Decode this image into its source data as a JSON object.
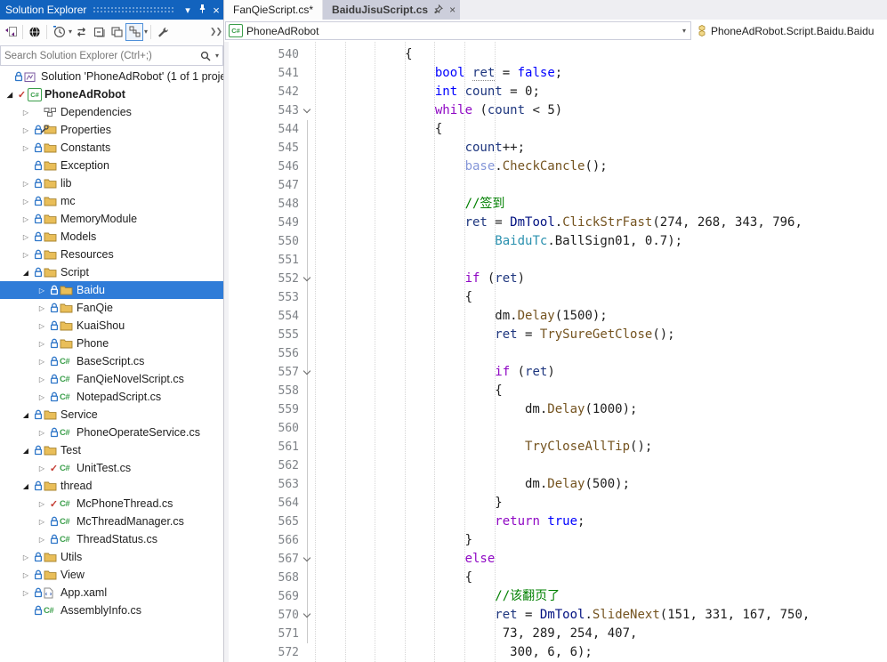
{
  "solution_explorer": {
    "title": "Solution Explorer",
    "titlebar_icons": [
      "window-position-icon",
      "pin-icon",
      "close-icon"
    ],
    "toolbar_icons": [
      "switch-views-icon",
      "pending-changes-filter-icon",
      "open-files-filter-icon",
      "sync-icon",
      "collapse-all-icon",
      "properties-icon",
      "sync-with-active-document-icon",
      "settings-wrench-icon",
      "overflow-icon"
    ],
    "search_placeholder": "Search Solution Explorer (Ctrl+;)",
    "search_icons": [
      "search-icon",
      "search-options-icon"
    ],
    "tree": [
      {
        "label": "Solution 'PhoneAdRobot' (1 of 1 proje",
        "indent": 0,
        "expander": "none",
        "badge": "lock",
        "icon": "solution",
        "selected": false
      },
      {
        "label": "PhoneAdRobot",
        "indent": 1,
        "expander": "open",
        "badge": "check",
        "icon": "project",
        "selected": false,
        "bold": true
      },
      {
        "label": "Dependencies",
        "indent": 2,
        "expander": "closed",
        "badge": "none",
        "icon": "deps",
        "selected": false
      },
      {
        "label": "Properties",
        "indent": 2,
        "expander": "closed",
        "badge": "lock",
        "icon": "folder-props",
        "selected": false
      },
      {
        "label": "Constants",
        "indent": 2,
        "expander": "closed",
        "badge": "lock",
        "icon": "folder",
        "selected": false
      },
      {
        "label": "Exception",
        "indent": 2,
        "expander": "none",
        "badge": "lock",
        "icon": "folder",
        "selected": false
      },
      {
        "label": "lib",
        "indent": 2,
        "expander": "closed",
        "badge": "lock",
        "icon": "folder",
        "selected": false
      },
      {
        "label": "mc",
        "indent": 2,
        "expander": "closed",
        "badge": "lock",
        "icon": "folder",
        "selected": false
      },
      {
        "label": "MemoryModule",
        "indent": 2,
        "expander": "closed",
        "badge": "lock",
        "icon": "folder",
        "selected": false
      },
      {
        "label": "Models",
        "indent": 2,
        "expander": "closed",
        "badge": "lock",
        "icon": "folder",
        "selected": false
      },
      {
        "label": "Resources",
        "indent": 2,
        "expander": "closed",
        "badge": "lock",
        "icon": "folder",
        "selected": false
      },
      {
        "label": "Script",
        "indent": 2,
        "expander": "open",
        "badge": "lock",
        "icon": "folder",
        "selected": false
      },
      {
        "label": "Baidu",
        "indent": 3,
        "expander": "closed",
        "badge": "lock",
        "icon": "folder",
        "selected": true
      },
      {
        "label": "FanQie",
        "indent": 3,
        "expander": "closed",
        "badge": "lock",
        "icon": "folder",
        "selected": false
      },
      {
        "label": "KuaiShou",
        "indent": 3,
        "expander": "closed",
        "badge": "lock",
        "icon": "folder",
        "selected": false
      },
      {
        "label": "Phone",
        "indent": 3,
        "expander": "closed",
        "badge": "lock",
        "icon": "folder",
        "selected": false
      },
      {
        "label": "BaseScript.cs",
        "indent": 3,
        "expander": "closed",
        "badge": "lock",
        "icon": "cs",
        "selected": false
      },
      {
        "label": "FanQieNovelScript.cs",
        "indent": 3,
        "expander": "closed",
        "badge": "lock",
        "icon": "cs",
        "selected": false
      },
      {
        "label": "NotepadScript.cs",
        "indent": 3,
        "expander": "closed",
        "badge": "lock",
        "icon": "cs",
        "selected": false
      },
      {
        "label": "Service",
        "indent": 2,
        "expander": "open",
        "badge": "lock",
        "icon": "folder",
        "selected": false
      },
      {
        "label": "PhoneOperateService.cs",
        "indent": 3,
        "expander": "closed",
        "badge": "lock",
        "icon": "cs",
        "selected": false
      },
      {
        "label": "Test",
        "indent": 2,
        "expander": "open",
        "badge": "lock",
        "icon": "folder",
        "selected": false
      },
      {
        "label": "UnitTest.cs",
        "indent": 3,
        "expander": "closed",
        "badge": "check",
        "icon": "cs",
        "selected": false
      },
      {
        "label": "thread",
        "indent": 2,
        "expander": "open",
        "badge": "lock",
        "icon": "folder",
        "selected": false
      },
      {
        "label": "McPhoneThread.cs",
        "indent": 3,
        "expander": "closed",
        "badge": "check",
        "icon": "cs",
        "selected": false
      },
      {
        "label": "McThreadManager.cs",
        "indent": 3,
        "expander": "closed",
        "badge": "lock",
        "icon": "cs",
        "selected": false
      },
      {
        "label": "ThreadStatus.cs",
        "indent": 3,
        "expander": "closed",
        "badge": "lock",
        "icon": "cs",
        "selected": false
      },
      {
        "label": "Utils",
        "indent": 2,
        "expander": "closed",
        "badge": "lock",
        "icon": "folder",
        "selected": false
      },
      {
        "label": "View",
        "indent": 2,
        "expander": "closed",
        "badge": "lock",
        "icon": "folder",
        "selected": false
      },
      {
        "label": "App.xaml",
        "indent": 2,
        "expander": "closed",
        "badge": "lock",
        "icon": "xaml",
        "selected": false
      },
      {
        "label": "AssemblyInfo.cs",
        "indent": 2,
        "expander": "none",
        "badge": "lock",
        "icon": "cs",
        "selected": false
      }
    ]
  },
  "editor": {
    "tabs": [
      {
        "label": "FanQieScript.cs*",
        "state": "inactive"
      },
      {
        "label": "BaiduJisuScript.cs",
        "state": "active-unfocused",
        "pin": true,
        "close": true
      }
    ],
    "breadcrumb": {
      "project": "PhoneAdRobot",
      "member_path": "PhoneAdRobot.Script.Baidu.Baidu"
    },
    "code": {
      "first_line_number": 540,
      "lines": [
        {
          "n": 540,
          "t": [
            [
              "pl",
              "            {"
            ]
          ]
        },
        {
          "n": 541,
          "t": [
            [
              "pl",
              "                "
            ],
            [
              "kw",
              "bool"
            ],
            [
              "pl",
              " "
            ],
            [
              "vd",
              "ret"
            ],
            [
              "pl",
              " = "
            ],
            [
              "kw",
              "false"
            ],
            [
              "pl",
              ";"
            ]
          ]
        },
        {
          "n": 542,
          "t": [
            [
              "pl",
              "                "
            ],
            [
              "kw",
              "int"
            ],
            [
              "pl",
              " "
            ],
            [
              "v",
              "count"
            ],
            [
              "pl",
              " = 0;"
            ]
          ]
        },
        {
          "n": 543,
          "f": true,
          "t": [
            [
              "pl",
              "                "
            ],
            [
              "ctrl",
              "while"
            ],
            [
              "pl",
              " ("
            ],
            [
              "v",
              "count"
            ],
            [
              "pl",
              " < 5)"
            ]
          ]
        },
        {
          "n": 544,
          "t": [
            [
              "pl",
              "                {"
            ]
          ]
        },
        {
          "n": 545,
          "t": [
            [
              "pl",
              "                    "
            ],
            [
              "v",
              "count"
            ],
            [
              "pl",
              "++;"
            ]
          ]
        },
        {
          "n": 546,
          "t": [
            [
              "pl",
              "                    "
            ],
            [
              "b",
              "base"
            ],
            [
              "pl",
              "."
            ],
            [
              "m",
              "CheckCancle"
            ],
            [
              "pl",
              "();"
            ]
          ]
        },
        {
          "n": 547,
          "t": []
        },
        {
          "n": 548,
          "t": [
            [
              "pl",
              "                    "
            ],
            [
              "c",
              "//签到"
            ]
          ]
        },
        {
          "n": 549,
          "t": [
            [
              "pl",
              "                    "
            ],
            [
              "v",
              "ret"
            ],
            [
              "pl",
              " = "
            ],
            [
              "cls",
              "DmTool"
            ],
            [
              "pl",
              "."
            ],
            [
              "m",
              "ClickStrFast"
            ],
            [
              "pl",
              "(274, 268, 343, 796,"
            ]
          ]
        },
        {
          "n": 550,
          "t": [
            [
              "pl",
              "                        "
            ],
            [
              "cls2",
              "BaiduTc"
            ],
            [
              "pl",
              "."
            ],
            [
              "pl",
              "BallSign01"
            ],
            [
              "pl",
              ", 0.7);"
            ]
          ]
        },
        {
          "n": 551,
          "t": []
        },
        {
          "n": 552,
          "f": true,
          "t": [
            [
              "pl",
              "                    "
            ],
            [
              "ctrl",
              "if"
            ],
            [
              "pl",
              " ("
            ],
            [
              "v",
              "ret"
            ],
            [
              "pl",
              ")"
            ]
          ]
        },
        {
          "n": 553,
          "t": [
            [
              "pl",
              "                    {"
            ]
          ]
        },
        {
          "n": 554,
          "t": [
            [
              "pl",
              "                        dm."
            ],
            [
              "m",
              "Delay"
            ],
            [
              "pl",
              "(1500);"
            ]
          ]
        },
        {
          "n": 555,
          "t": [
            [
              "pl",
              "                        "
            ],
            [
              "v",
              "ret"
            ],
            [
              "pl",
              " = "
            ],
            [
              "m",
              "TrySureGetClose"
            ],
            [
              "pl",
              "();"
            ]
          ]
        },
        {
          "n": 556,
          "t": []
        },
        {
          "n": 557,
          "f": true,
          "t": [
            [
              "pl",
              "                        "
            ],
            [
              "ctrl",
              "if"
            ],
            [
              "pl",
              " ("
            ],
            [
              "v",
              "ret"
            ],
            [
              "pl",
              ")"
            ]
          ]
        },
        {
          "n": 558,
          "t": [
            [
              "pl",
              "                        {"
            ]
          ]
        },
        {
          "n": 559,
          "t": [
            [
              "pl",
              "                            dm."
            ],
            [
              "m",
              "Delay"
            ],
            [
              "pl",
              "(1000);"
            ]
          ]
        },
        {
          "n": 560,
          "t": []
        },
        {
          "n": 561,
          "t": [
            [
              "pl",
              "                            "
            ],
            [
              "m",
              "TryCloseAllTip"
            ],
            [
              "pl",
              "();"
            ]
          ]
        },
        {
          "n": 562,
          "t": []
        },
        {
          "n": 563,
          "t": [
            [
              "pl",
              "                            dm."
            ],
            [
              "m",
              "Delay"
            ],
            [
              "pl",
              "(500);"
            ]
          ]
        },
        {
          "n": 564,
          "t": [
            [
              "pl",
              "                        }"
            ]
          ]
        },
        {
          "n": 565,
          "t": [
            [
              "pl",
              "                        "
            ],
            [
              "ctrl",
              "return"
            ],
            [
              "pl",
              " "
            ],
            [
              "kw",
              "true"
            ],
            [
              "pl",
              ";"
            ]
          ]
        },
        {
          "n": 566,
          "t": [
            [
              "pl",
              "                    }"
            ]
          ]
        },
        {
          "n": 567,
          "f": true,
          "t": [
            [
              "pl",
              "                    "
            ],
            [
              "ctrl",
              "else"
            ]
          ]
        },
        {
          "n": 568,
          "t": [
            [
              "pl",
              "                    {"
            ]
          ]
        },
        {
          "n": 569,
          "t": [
            [
              "pl",
              "                        "
            ],
            [
              "c",
              "//该翻页了"
            ]
          ]
        },
        {
          "n": 570,
          "f": true,
          "t": [
            [
              "pl",
              "                        "
            ],
            [
              "v",
              "ret"
            ],
            [
              "pl",
              " = "
            ],
            [
              "cls",
              "DmTool"
            ],
            [
              "pl",
              "."
            ],
            [
              "m",
              "SlideNext"
            ],
            [
              "pl",
              "(151, 331, 167, 750,"
            ]
          ]
        },
        {
          "n": 571,
          "t": [
            [
              "pl",
              "                         73, 289, 254, 407,"
            ]
          ]
        },
        {
          "n": 572,
          "t": [
            [
              "pl",
              "                          300, 6, 6);"
            ]
          ]
        }
      ]
    }
  },
  "colors": {
    "titlebar": "#1263BE",
    "tree_selection": "#2F7CD8",
    "tab_active_bg": "#CCCEDB",
    "tabstrip_bg": "#EEEEF2",
    "keyword": "#0000FF",
    "control_keyword": "#8F08C4",
    "method": "#74531F",
    "local_variable": "#1F377F",
    "base_keyword": "#8496D8",
    "comment": "#008000",
    "static_class": "#001080",
    "type_class": "#2B91AF",
    "line_number": "#7E8287",
    "lock_badge": "#2E76C8",
    "check_badge": "#C43C33",
    "folder": "#E9BE59"
  }
}
